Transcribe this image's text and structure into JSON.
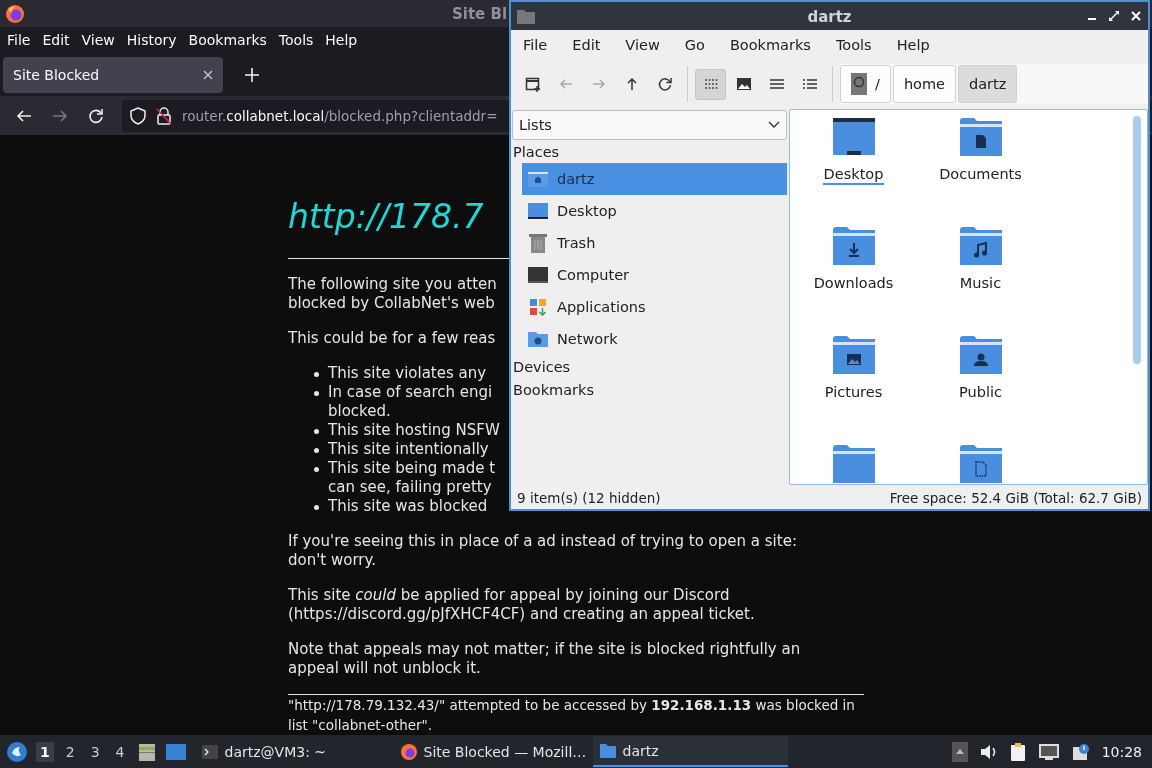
{
  "firefox": {
    "title": "Site Bl",
    "menu": [
      "File",
      "Edit",
      "View",
      "History",
      "Bookmarks",
      "Tools",
      "Help"
    ],
    "tabs": [
      {
        "label": "Site Blocked",
        "selected": true
      }
    ],
    "url": {
      "subdomain": "router.",
      "domain": "collabnet.local",
      "path": "/blocked.php?clientaddr="
    },
    "page": {
      "heading": "http://178.7",
      "blocks": [
        {
          "kind": "paragraph",
          "lines": [
            "The following site you atten",
            "blocked by CollabNet's web"
          ]
        },
        {
          "kind": "paragraph",
          "lines": [
            "This could be for a few reas"
          ]
        },
        {
          "kind": "bullets",
          "items": [
            {
              "lines": [
                "This site violates any"
              ]
            },
            {
              "lines": [
                "In case of search engi",
                "blocked."
              ]
            },
            {
              "lines": [
                "This site hosting NSFW"
              ]
            },
            {
              "lines": [
                "This site intentionally"
              ]
            },
            {
              "lines": [
                "This site being made t",
                "can see, failing pretty"
              ]
            },
            {
              "lines": [
                "This site was blocked"
              ]
            }
          ]
        },
        {
          "kind": "paragraph",
          "lines": [
            "If you're seeing this in place of a ad instead of trying to open a site:",
            "don't worry."
          ]
        },
        {
          "kind": "paragraph",
          "lines": [
            "This site *could* be applied for appeal by joining our Discord",
            "(https://discord.gg/pJfXHCF4CF) and creating an appeal ticket."
          ]
        },
        {
          "kind": "paragraph",
          "lines": [
            "Note that appeals may not matter; if the site is blocked rightfully an",
            "appeal will not unblock it."
          ]
        }
      ],
      "footer": [
        "\"http://178.79.132.43/\" attempted to be accessed by **192.168.1.13** was blocked in",
        "list \"collabnet-other\"."
      ]
    }
  },
  "file_manager": {
    "title": "dartz",
    "menu": [
      "File",
      "Edit",
      "View",
      "Go",
      "Bookmarks",
      "Tools",
      "Help"
    ],
    "toolbar": [
      {
        "kind": "new-window",
        "disabled": false,
        "selected": false
      },
      {
        "kind": "back",
        "disabled": true,
        "selected": false
      },
      {
        "kind": "forward",
        "disabled": true,
        "selected": false
      },
      {
        "kind": "up",
        "disabled": false,
        "selected": false
      },
      {
        "kind": "reload",
        "disabled": false,
        "selected": false
      },
      {
        "kind": "icon-view",
        "disabled": false,
        "selected": true
      },
      {
        "kind": "thumbnail-view",
        "disabled": false,
        "selected": false
      },
      {
        "kind": "compact-view",
        "disabled": false,
        "selected": false
      },
      {
        "kind": "detail-view",
        "disabled": false,
        "selected": false
      }
    ],
    "path": [
      {
        "kind": "root",
        "label": "/",
        "selected": false
      },
      {
        "kind": "dir",
        "label": "home",
        "selected": false
      },
      {
        "kind": "dir",
        "label": "dartz",
        "selected": true
      }
    ],
    "side_view": "Lists",
    "sections": [
      {
        "title": "Places",
        "items": [
          {
            "label": "dartz",
            "kind": "home",
            "selected": true
          },
          {
            "label": "Desktop",
            "kind": "desktop",
            "selected": false
          },
          {
            "label": "Trash",
            "kind": "trash",
            "selected": false
          },
          {
            "label": "Computer",
            "kind": "computer",
            "selected": false
          },
          {
            "label": "Applications",
            "kind": "applications",
            "selected": false
          },
          {
            "label": "Network",
            "kind": "network",
            "selected": false
          }
        ]
      },
      {
        "title": "Devices"
      },
      {
        "title": "Bookmarks"
      }
    ],
    "files": [
      {
        "label": "Desktop",
        "kind": "desktop",
        "focused": true
      },
      {
        "label": "Documents",
        "kind": "documents",
        "focused": false
      },
      {
        "label": "Downloads",
        "kind": "downloads",
        "focused": false
      },
      {
        "label": "Music",
        "kind": "music",
        "focused": false
      },
      {
        "label": "Pictures",
        "kind": "pictures",
        "focused": false
      },
      {
        "label": "Public",
        "kind": "public",
        "focused": false
      },
      {
        "kind": "folder"
      },
      {
        "kind": "templates"
      }
    ],
    "status_left": "9 item(s) (12 hidden)",
    "status_right": "Free space: 52.4 GiB (Total: 62.7 GiB)"
  },
  "taskbar": {
    "workspaces": [
      {
        "label": "1",
        "selected": true
      },
      {
        "label": "2",
        "selected": false
      },
      {
        "label": "3",
        "selected": false
      },
      {
        "label": "4",
        "selected": false
      }
    ],
    "tasks": [
      {
        "label": "dartz@VM3: ~",
        "kind": "terminal",
        "selected": false
      },
      {
        "label": "Site Blocked — Mozill…",
        "kind": "firefox",
        "selected": false
      },
      {
        "label": "dartz",
        "kind": "folder",
        "selected": true
      }
    ],
    "clock": "10:28"
  }
}
